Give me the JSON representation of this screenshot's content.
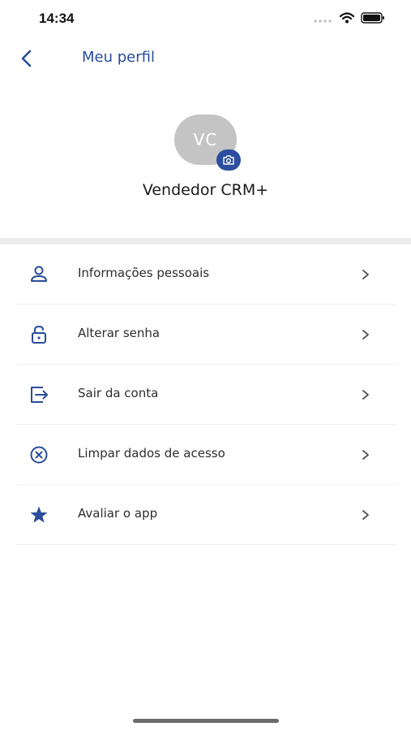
{
  "status_bar": {
    "time": "14:34",
    "signal_icon": "cellular-dots-icon",
    "wifi_icon": "wifi-icon",
    "battery_icon": "battery-icon"
  },
  "nav": {
    "title": "Meu perfil",
    "back_icon": "chevron-left-icon"
  },
  "profile": {
    "initials": "VC",
    "name": "Vendedor CRM+",
    "camera_icon": "camera-icon"
  },
  "menu": [
    {
      "label": "Informações pessoais",
      "icon": "person-icon"
    },
    {
      "label": "Alterar senha",
      "icon": "lock-icon"
    },
    {
      "label": "Sair da conta",
      "icon": "logout-icon"
    },
    {
      "label": "Limpar dados de acesso",
      "icon": "clear-circle-icon"
    },
    {
      "label": "Avaliar o app",
      "icon": "star-icon"
    }
  ],
  "colors": {
    "accent": "#2a4c9a",
    "avatar_bg": "#c4c4c4",
    "chevron": "#555555"
  }
}
